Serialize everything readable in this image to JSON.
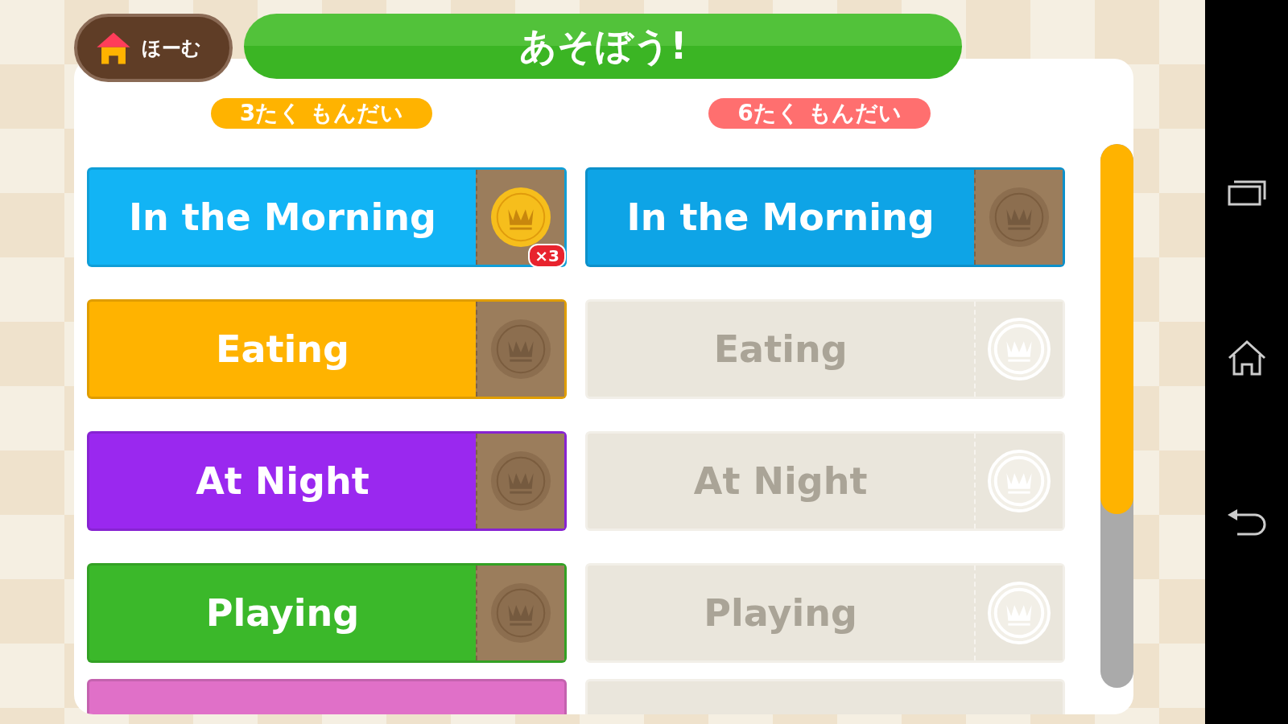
{
  "home_button": {
    "label": "ほーむ"
  },
  "title": "あそぼう!",
  "columns": [
    {
      "heading": "3たく もんだい",
      "color": "#ffb300",
      "items": [
        {
          "label": "In the Morning",
          "color": "#12b4f5",
          "disabled": false,
          "crown_earned": true,
          "badge": "×3"
        },
        {
          "label": "Eating",
          "color": "#ffb300",
          "disabled": false,
          "crown_earned": false
        },
        {
          "label": "At Night",
          "color": "#9a28ef",
          "disabled": false,
          "crown_earned": false
        },
        {
          "label": "Playing",
          "color": "#3bb82a",
          "disabled": false,
          "crown_earned": false
        }
      ],
      "peek": {
        "color": "#e070c8",
        "disabled": false
      }
    },
    {
      "heading": "6たく もんだい",
      "color": "#ff6f6f",
      "items": [
        {
          "label": "In the Morning",
          "color": "#0ea4e6",
          "disabled": false,
          "crown_earned": false
        },
        {
          "label": "Eating",
          "disabled": true,
          "crown_earned": false
        },
        {
          "label": "At Night",
          "disabled": true,
          "crown_earned": false
        },
        {
          "label": "Playing",
          "disabled": true,
          "crown_earned": false
        }
      ],
      "peek": {
        "disabled": true
      }
    }
  ],
  "scrollbar": {
    "level": 0.68
  }
}
